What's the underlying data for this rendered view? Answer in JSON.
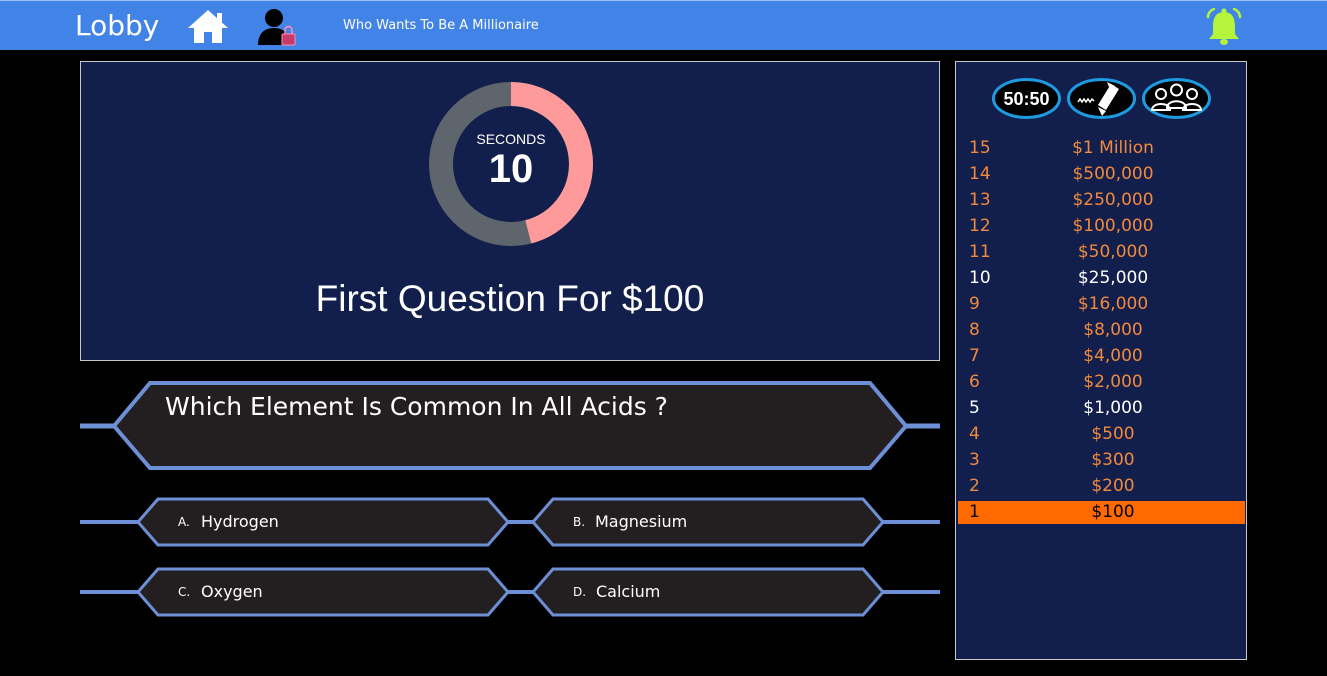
{
  "header": {
    "lobby_label": "Lobby",
    "home_icon": "home-icon",
    "profile_icon": "user-lock-icon",
    "game_title": "Who Wants To Be A Millionaire",
    "notification_icon": "bell-icon",
    "bar_color": "#4183e6",
    "bell_color": "#b4f53c"
  },
  "timer": {
    "seconds_label": "SECONDS",
    "seconds_value": "10",
    "fraction_remaining": 0.46,
    "ring_color_remaining": "#ff9a9a",
    "ring_color_elapsed": "#5f656c"
  },
  "question": {
    "heading": "First Question For $100",
    "text": "Which Element Is Common In All Acids ?"
  },
  "answers": [
    {
      "letter": "A.",
      "text": "Hydrogen"
    },
    {
      "letter": "B.",
      "text": "Magnesium"
    },
    {
      "letter": "C.",
      "text": "Oxygen"
    },
    {
      "letter": "D.",
      "text": "Calcium"
    }
  ],
  "lifelines": [
    {
      "label": "50:50",
      "icon": "fifty-fifty-icon"
    },
    {
      "label": "",
      "icon": "phone-a-friend-icon"
    },
    {
      "label": "",
      "icon": "ask-the-audience-icon"
    }
  ],
  "ladder": [
    {
      "level": "15",
      "amount": "$1 Million",
      "style": "orange"
    },
    {
      "level": "14",
      "amount": "$500,000",
      "style": "orange"
    },
    {
      "level": "13",
      "amount": "$250,000",
      "style": "orange"
    },
    {
      "level": "12",
      "amount": "$100,000",
      "style": "orange"
    },
    {
      "level": "11",
      "amount": "$50,000",
      "style": "orange"
    },
    {
      "level": "10",
      "amount": "$25,000",
      "style": "white"
    },
    {
      "level": "9",
      "amount": "$16,000",
      "style": "orange"
    },
    {
      "level": "8",
      "amount": "$8,000",
      "style": "orange"
    },
    {
      "level": "7",
      "amount": "$4,000",
      "style": "orange"
    },
    {
      "level": "6",
      "amount": "$2,000",
      "style": "orange"
    },
    {
      "level": "5",
      "amount": "$1,000",
      "style": "white"
    },
    {
      "level": "4",
      "amount": "$500",
      "style": "orange"
    },
    {
      "level": "3",
      "amount": "$300",
      "style": "orange"
    },
    {
      "level": "2",
      "amount": "$200",
      "style": "orange"
    },
    {
      "level": "1",
      "amount": "$100",
      "style": "current"
    }
  ],
  "colors": {
    "panel_bg": "#121e4c",
    "ladder_text": "#f08a3c",
    "ladder_current": "#ff6a00",
    "hex_border": "#6d8fd6",
    "hex_fill": "#231f20"
  }
}
